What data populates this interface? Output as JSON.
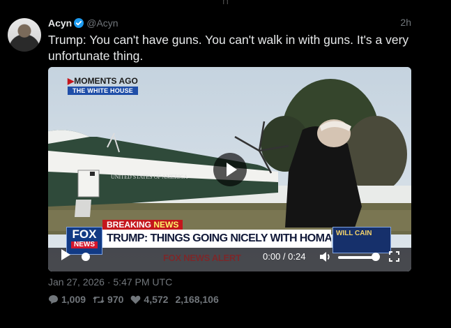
{
  "top_glyph": "[ ]",
  "author": {
    "name": "Acyn",
    "handle": "@Acyn"
  },
  "timestamp_relative": "2h",
  "tweet_text": "Trump: You can't have guns. You can't walk in with guns. It's a very unfortunate thing.",
  "video": {
    "bug_line1": "MOMENTS AGO",
    "bug_line2": "THE WHITE HOUSE",
    "helicopter_text": "UNITED STATES OF AMERICA",
    "breaking_label_a": "BREAKING",
    "breaking_label_b": "NEWS",
    "headline": "TRUMP: THINGS GOING NICELY WITH HOMAN IN MN",
    "logo_top": "FOX",
    "logo_bottom": "NEWS",
    "promo_text": "WILL CAIN",
    "ticker": "FOX NEWS ALERT",
    "time_readout": "0:00 / 0:24",
    "progress": 0,
    "volume": 1.0
  },
  "posted_at": "Jan 27, 2026 · 5:47 PM UTC",
  "stats": {
    "replies": "1,009",
    "retweets": "970",
    "likes": "4,572",
    "views": "2,168,106"
  },
  "colors": {
    "background": "#000000",
    "text": "#e7e9ea",
    "muted": "#71767b",
    "verified": "#1d9bf0",
    "breaking_red": "#c4161c",
    "fox_blue": "#123a84"
  },
  "icons": [
    "verified-badge-icon",
    "play-icon",
    "volume-icon",
    "fullscreen-icon",
    "reply-icon",
    "retweet-icon",
    "like-icon"
  ]
}
